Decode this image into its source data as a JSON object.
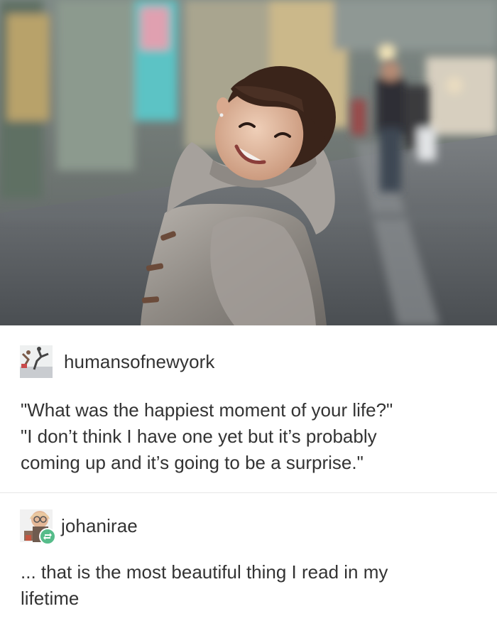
{
  "image": {
    "alt": "Smiling girl in a gray hooded jacket on a city street",
    "colors": {
      "coat": "#9a9590",
      "hair": "#3a241a",
      "street": "#5b5f63"
    }
  },
  "post": {
    "username": "humansofnewyork",
    "avatar_icon": "humansofnewyork-avatar-icon",
    "lines": [
      "\"What was the happiest moment of your life?\"",
      "\"I don’t think I have one yet but it’s probably",
      "coming up and it’s going to be a surprise.\""
    ]
  },
  "reblog": {
    "username": "johanirae",
    "avatar_icon": "johanirae-avatar-icon",
    "badge_icon": "reblog-icon",
    "badge_color": "#56bc8a",
    "lines": [
      "... that is the most beautiful thing I read in my",
      "lifetime"
    ]
  }
}
